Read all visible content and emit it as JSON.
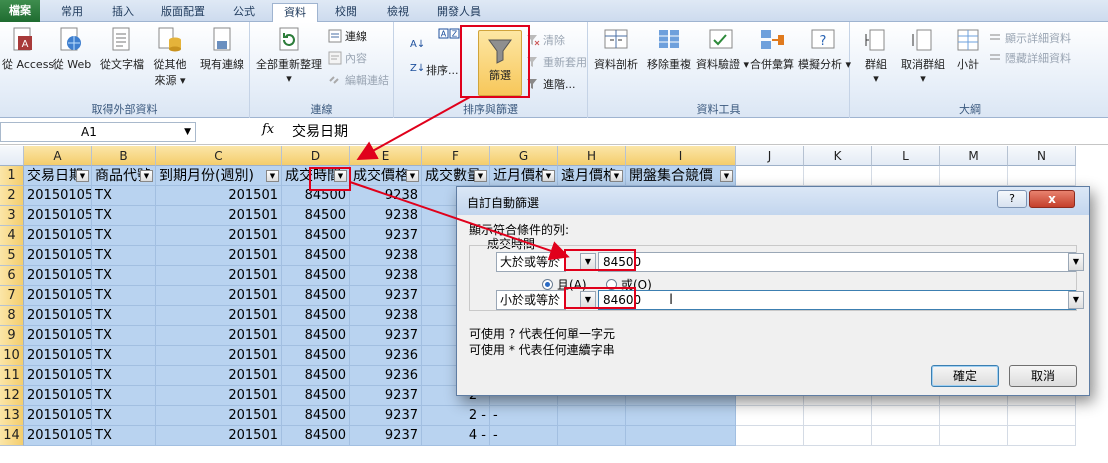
{
  "tabs": [
    "檔案",
    "常用",
    "插入",
    "版面配置",
    "公式",
    "資料",
    "校閱",
    "檢視",
    "開發人員"
  ],
  "active_tab": "資料",
  "ribbon": {
    "external_data": {
      "label": "取得外部資料",
      "access": "從 Access",
      "web": "從 Web",
      "text": "從文字檔",
      "other1": "從其他",
      "other2": "來源",
      "existing": "現有連線"
    },
    "connections": {
      "label": "連線",
      "refresh_all": "全部重新整理",
      "connections": "連線",
      "properties": "內容",
      "edit_links": "編輯連結"
    },
    "sort_filter": {
      "label": "排序與篩選",
      "sort": "排序...",
      "filter": "篩選",
      "clear": "清除",
      "reapply": "重新套用",
      "advanced": "進階..."
    },
    "data_tools": {
      "label": "資料工具",
      "text_to_columns": "資料剖析",
      "remove_duplicates": "移除重複",
      "data_validation": "資料驗證",
      "consolidate": "合併彙算",
      "what_if": "模擬分析"
    },
    "outline": {
      "label": "大綱",
      "group": "群組",
      "ungroup": "取消群組",
      "subtotal": "小計",
      "show_detail": "顯示詳細資料",
      "hide_detail": "隱藏詳細資料"
    }
  },
  "formula_bar": {
    "name_box": "A1",
    "fx": "fx",
    "value": "交易日期"
  },
  "columns": [
    "A",
    "B",
    "C",
    "D",
    "E",
    "F",
    "G",
    "H",
    "I",
    "J",
    "K",
    "L",
    "M",
    "N"
  ],
  "header_row": [
    "交易日期",
    "商品代號",
    "到期月份(週別)",
    "成交時間",
    "成交價格",
    "成交數量",
    "近月價格",
    "遠月價格",
    "開盤集合競價"
  ],
  "rows": [
    {
      "n": "1"
    },
    {
      "n": "2",
      "a": "20150105",
      "b": "TX",
      "c": "201501",
      "d": "84500",
      "e": "9238",
      "f": "",
      "g": ""
    },
    {
      "n": "3",
      "a": "20150105",
      "b": "TX",
      "c": "201501",
      "d": "84500",
      "e": "9238",
      "f": "",
      "g": ""
    },
    {
      "n": "4",
      "a": "20150105",
      "b": "TX",
      "c": "201501",
      "d": "84500",
      "e": "9237",
      "f": "",
      "g": ""
    },
    {
      "n": "5",
      "a": "20150105",
      "b": "TX",
      "c": "201501",
      "d": "84500",
      "e": "9238",
      "f": "",
      "g": ""
    },
    {
      "n": "6",
      "a": "20150105",
      "b": "TX",
      "c": "201501",
      "d": "84500",
      "e": "9238",
      "f": "",
      "g": ""
    },
    {
      "n": "7",
      "a": "20150105",
      "b": "TX",
      "c": "201501",
      "d": "84500",
      "e": "9237",
      "f": "",
      "g": ""
    },
    {
      "n": "8",
      "a": "20150105",
      "b": "TX",
      "c": "201501",
      "d": "84500",
      "e": "9238",
      "f": "",
      "g": ""
    },
    {
      "n": "9",
      "a": "20150105",
      "b": "TX",
      "c": "201501",
      "d": "84500",
      "e": "9237",
      "f": "",
      "g": ""
    },
    {
      "n": "10",
      "a": "20150105",
      "b": "TX",
      "c": "201501",
      "d": "84500",
      "e": "9236",
      "f": "",
      "g": ""
    },
    {
      "n": "11",
      "a": "20150105",
      "b": "TX",
      "c": "201501",
      "d": "84500",
      "e": "9236",
      "f": "",
      "g": ""
    },
    {
      "n": "12",
      "a": "20150105",
      "b": "TX",
      "c": "201501",
      "d": "84500",
      "e": "9237",
      "f": "2 -",
      "g": "-"
    },
    {
      "n": "13",
      "a": "20150105",
      "b": "TX",
      "c": "201501",
      "d": "84500",
      "e": "9237",
      "f": "2 -",
      "g": "-"
    },
    {
      "n": "14",
      "a": "20150105",
      "b": "TX",
      "c": "201501",
      "d": "84500",
      "e": "9237",
      "f": "4 -",
      "g": "-"
    }
  ],
  "dialog": {
    "title": "自訂自動篩選",
    "help": "?",
    "close": "x",
    "show_rows": "顯示符合條件的列:",
    "field": "成交時間",
    "op1": "大於或等於",
    "value1": "84500",
    "and": "且(A)",
    "or": "或(O)",
    "op2": "小於或等於",
    "value2": "84600",
    "hint1": "可使用 ? 代表任何單一字元",
    "hint2": "可使用 * 代表任何連續字串",
    "ok": "確定",
    "cancel": "取消"
  },
  "colors": {
    "highlight": "#b9d3f0",
    "annotation": "#e0001b",
    "file_tab": "#2a7a3b"
  }
}
